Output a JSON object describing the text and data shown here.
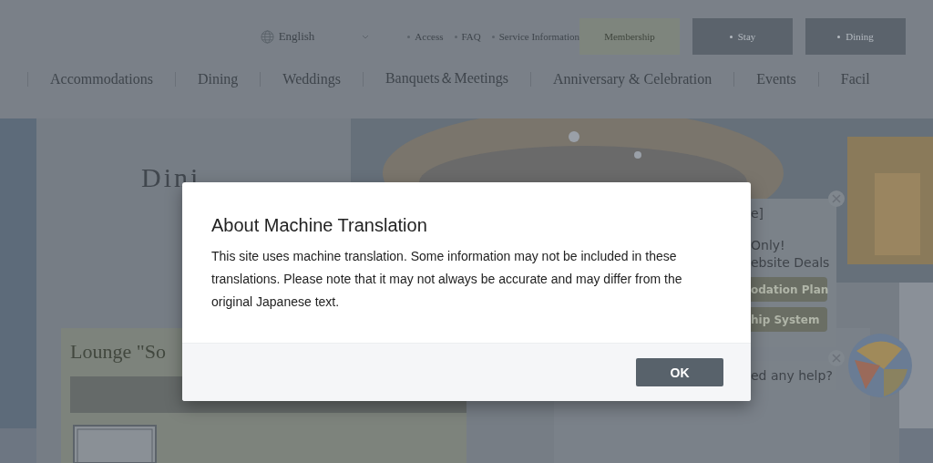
{
  "header": {
    "language": "English",
    "links": [
      "Access",
      "FAQ",
      "Service Information"
    ],
    "buttons": [
      {
        "label": "Membership",
        "kind": "plain"
      },
      {
        "label": "Stay",
        "kind": "dark"
      },
      {
        "label": "Dining",
        "kind": "dark"
      }
    ]
  },
  "nav": [
    "Accommodations",
    "Dining",
    "Weddings",
    "Banquets＆Meetings",
    "Anniversary & Celebration",
    "Events",
    "Facil"
  ],
  "page": {
    "title": "Dini",
    "card_title": "Lounge \"So"
  },
  "promo": {
    "heading": "e]",
    "lines": [
      "Only!",
      "ebsite Deals"
    ],
    "buttons": [
      "odation Plan",
      "hip System"
    ]
  },
  "chat": {
    "text": "ed any help?"
  },
  "dialog": {
    "title": "About Machine Translation",
    "body": "This site uses machine translation. Some information may not be included in these translations. Please note that it may not always be accurate and may differ from the original Japanese text.",
    "button": "OK"
  }
}
